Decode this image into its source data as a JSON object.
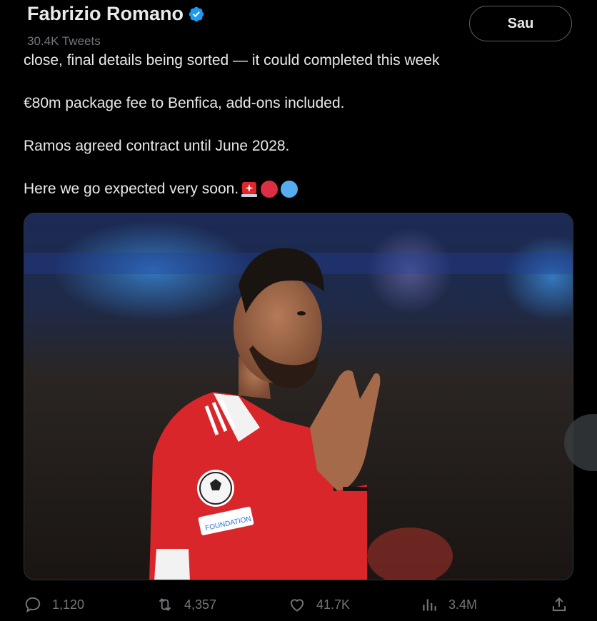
{
  "header": {
    "author_name": "Fabrizio Romano",
    "tweet_count": "30.4K Tweets",
    "follow_label": "Sau"
  },
  "tweet": {
    "lines": [
      "close, final details being sorted — it could completed this week",
      "€80m package fee to Benfica, add-ons included.",
      "Ramos agreed contract until June 2028.",
      "Here we go expected very soon."
    ],
    "emojis": [
      "rotating-light-emoji",
      "red-circle-emoji",
      "blue-circle-emoji"
    ]
  },
  "media": {
    "description_icon": "photo-of-footballer",
    "badge_text": "FOUNDATION"
  },
  "actions": {
    "replies": "1,120",
    "retweets": "4,357",
    "likes": "41.7K",
    "views": "3.4M"
  },
  "colors": {
    "background": "#000000",
    "text": "#e7e9ea",
    "muted": "#71767b",
    "verified": "#1d9bf0",
    "jersey_red": "#e0262b"
  }
}
